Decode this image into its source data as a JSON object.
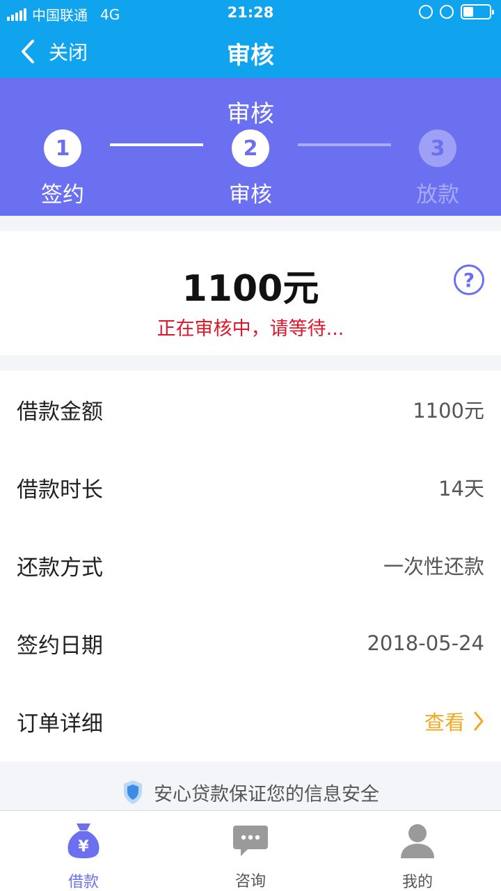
{
  "status_bar": {
    "carrier": "中国联通",
    "network": "4G",
    "time": "21:28"
  },
  "nav": {
    "close_label": "关闭",
    "title": "审核"
  },
  "steps": {
    "heading": "审核",
    "items": [
      {
        "number": "1",
        "label": "签约",
        "state": "done"
      },
      {
        "number": "2",
        "label": "审核",
        "state": "current"
      },
      {
        "number": "3",
        "label": "放款",
        "state": "pending"
      }
    ]
  },
  "amount_card": {
    "amount": "1100元",
    "status": "正在审核中，请等待..."
  },
  "details": [
    {
      "key": "借款金额",
      "value": "1100元"
    },
    {
      "key": "借款时长",
      "value": "14天"
    },
    {
      "key": "还款方式",
      "value": "一次性还款"
    },
    {
      "key": "签约日期",
      "value": "2018-05-24"
    },
    {
      "key": "订单详细",
      "value": "查看"
    }
  ],
  "notice": "安心贷款保证您的信息安全",
  "tabs": [
    {
      "label": "借款",
      "icon": "money-bag-icon",
      "active": true
    },
    {
      "label": "咨询",
      "icon": "chat-icon",
      "active": false
    },
    {
      "label": "我的",
      "icon": "user-icon",
      "active": false
    }
  ],
  "colors": {
    "primary_blue": "#10a3ee",
    "header_purple": "#6b70f0",
    "alert_red": "#e0162b",
    "link_orange": "#f0a820"
  }
}
